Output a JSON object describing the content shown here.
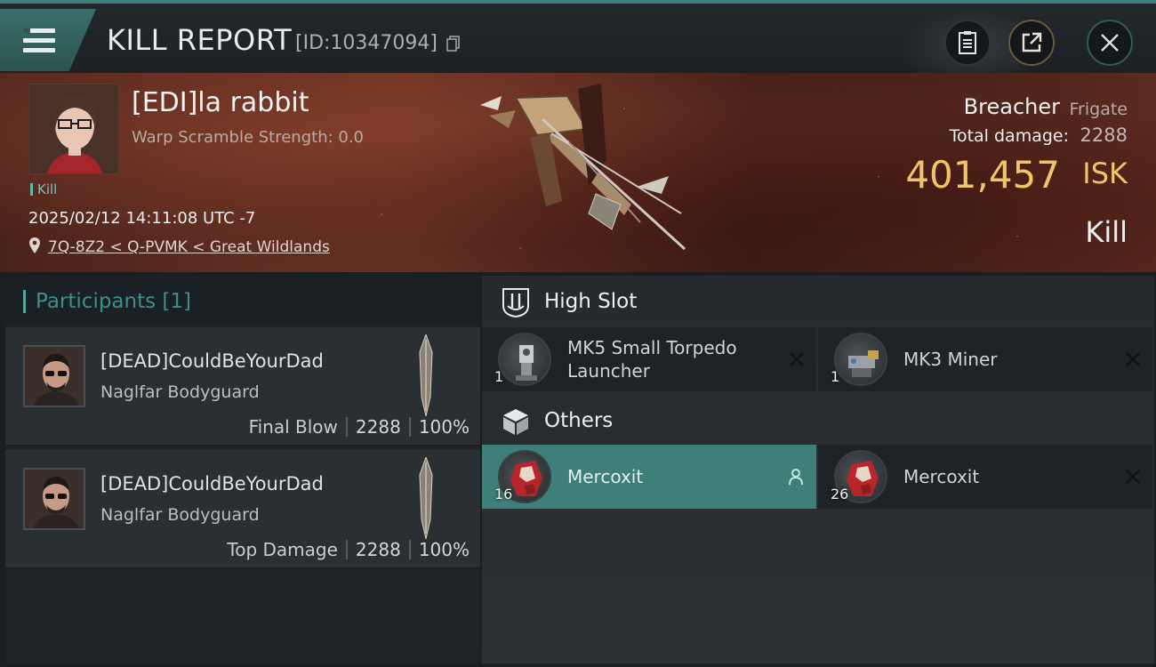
{
  "header": {
    "title": "KILL REPORT",
    "report_id": "[ID:10347094]",
    "icons": [
      "menu-icon",
      "copy-icon",
      "clipboard-icon",
      "share-icon",
      "close-icon"
    ]
  },
  "victim": {
    "name": "[EDI]la rabbit",
    "warp_scramble": "Warp Scramble Strength: 0.0",
    "tag": "Kill",
    "datetime": "2025/02/12 14:11:08 UTC -7",
    "location": "7Q-8Z2 < Q-PVMK < Great Wildlands",
    "ship_name": "Breacher",
    "ship_class": "Frigate",
    "total_damage_label": "Total damage:",
    "total_damage": "2288",
    "isk_value": "401,457",
    "isk_unit": "ISK",
    "status": "Kill"
  },
  "participants": {
    "title": "Participants",
    "count": "[1]",
    "rows": [
      {
        "name": "[DEAD]CouldBeYourDad",
        "ship": "Naglfar Bodyguard",
        "label": "Final Blow",
        "damage": "2288",
        "percent": "100%"
      },
      {
        "name": "[DEAD]CouldBeYourDad",
        "ship": "Naglfar Bodyguard",
        "label": "Top Damage",
        "damage": "2288",
        "percent": "100%"
      }
    ]
  },
  "high_slot": {
    "title": "High Slot",
    "items": [
      {
        "name": "MK5 Small Torpedo Launcher",
        "qty": "1"
      },
      {
        "name": "MK3 Miner",
        "qty": "1"
      }
    ]
  },
  "others": {
    "title": "Others",
    "items": [
      {
        "name": "Mercoxit",
        "qty": "16"
      },
      {
        "name": "Mercoxit",
        "qty": "26"
      }
    ]
  },
  "colors": {
    "accent_teal": "#3f7f7a",
    "isk_gold": "#f2c46a",
    "participants_title": "#3d8f8a"
  }
}
